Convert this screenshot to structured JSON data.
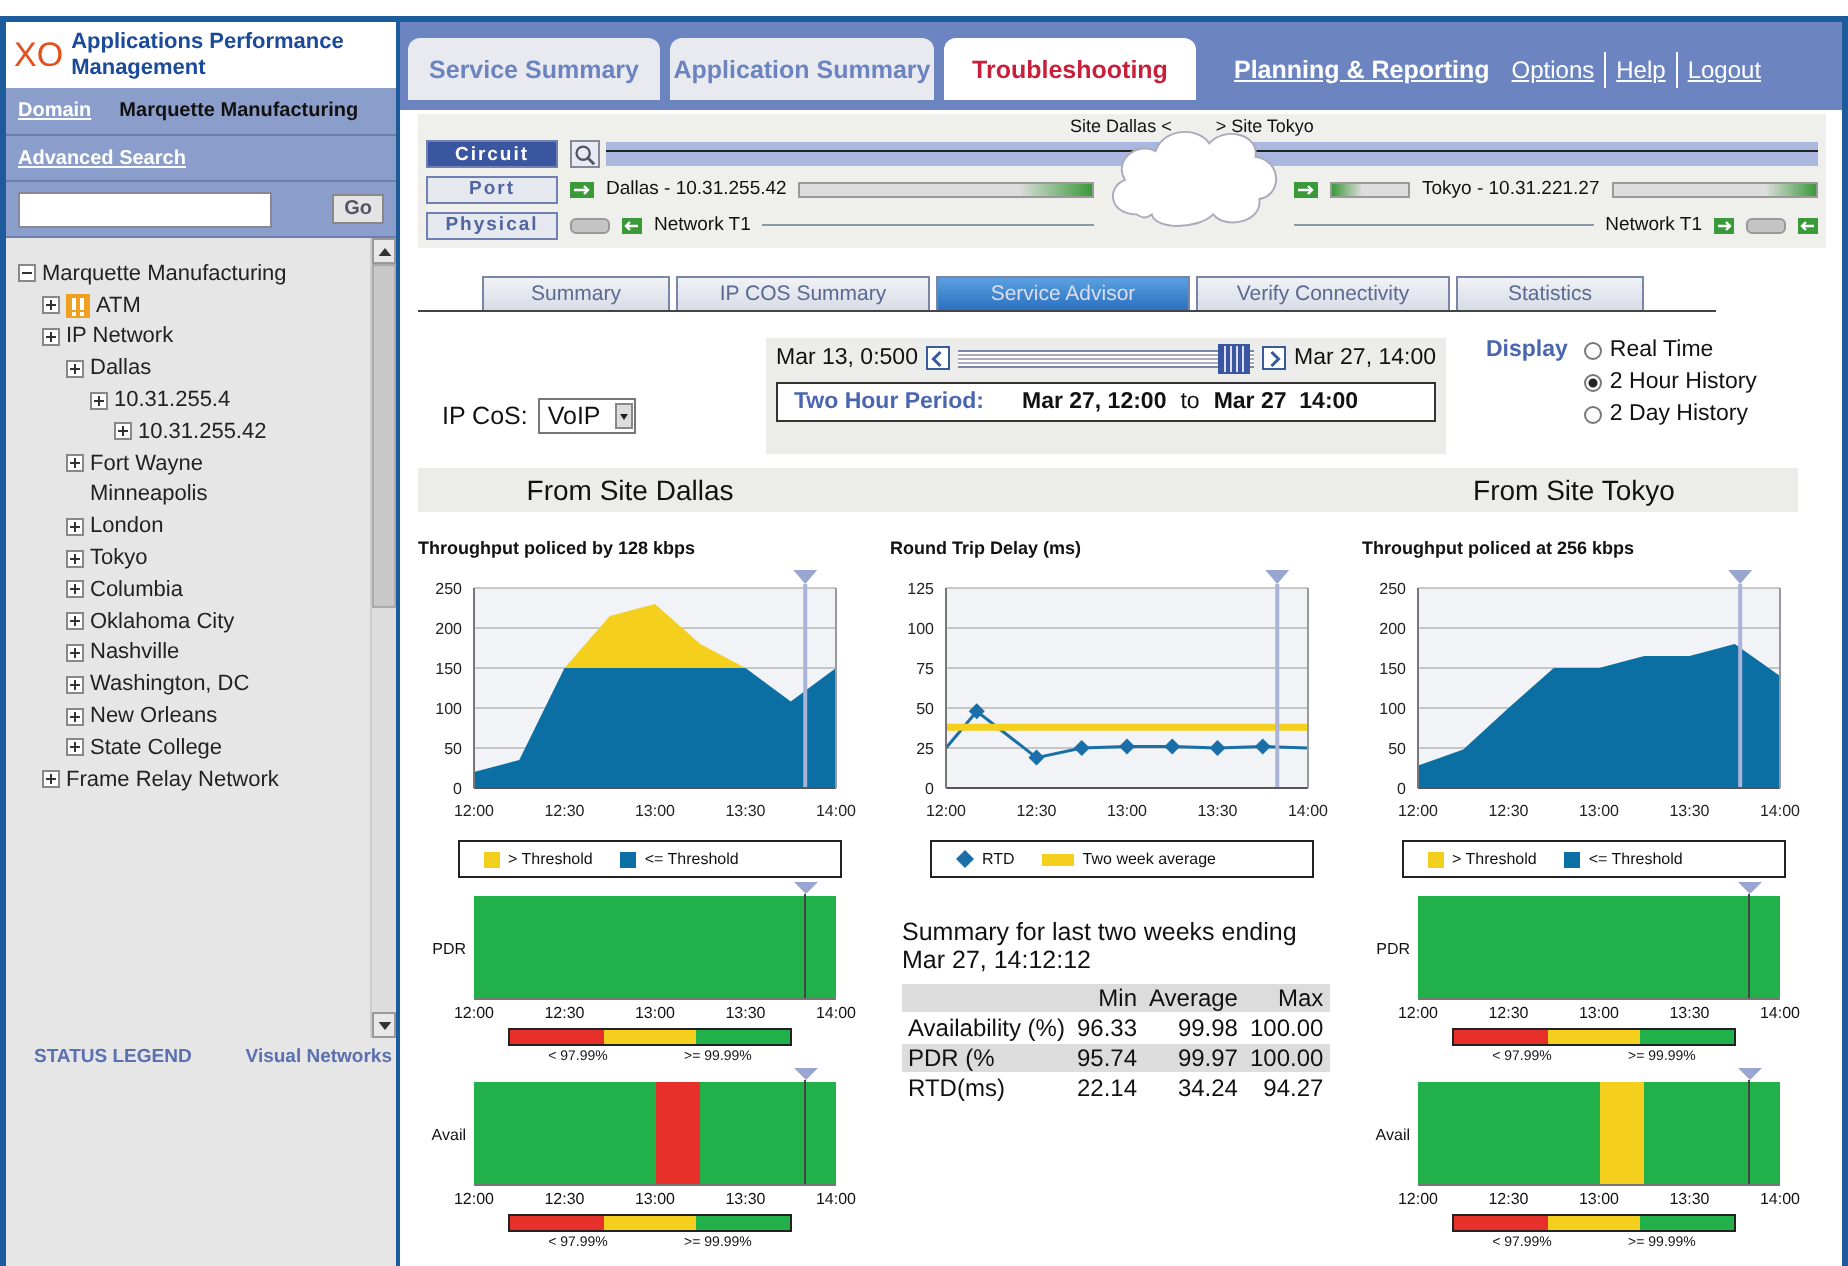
{
  "sidebar": {
    "logo": "XO",
    "title": "Applications Performance Management",
    "domain_link": "Domain",
    "domain_value": "Marquette Manufacturing",
    "advanced_search": "Advanced Search",
    "search": {
      "button": "Go"
    },
    "tree": [
      {
        "label": "Marquette Manufacturing",
        "expanded": true,
        "alert": false,
        "children": [
          {
            "label": "ATM",
            "expanded": false,
            "alert": true
          },
          {
            "label": "IP Network",
            "expanded": false,
            "alert": false,
            "children": [
              {
                "label": "Dallas",
                "expanded": false,
                "alert": false,
                "children": [
                  {
                    "label": "10.31.255.4",
                    "expanded": false,
                    "alert": false,
                    "children": [
                      {
                        "label": "10.31.255.42",
                        "expanded": false,
                        "alert": false
                      }
                    ]
                  }
                ]
              },
              {
                "label": "Fort Wayne",
                "expanded": false,
                "alert": false
              },
              {
                "label": "Minneapolis",
                "alert": false
              },
              {
                "label": "London",
                "expanded": false,
                "alert": false
              },
              {
                "label": "Tokyo",
                "expanded": false,
                "alert": false
              },
              {
                "label": "Columbia",
                "expanded": false,
                "alert": false
              },
              {
                "label": "Oklahoma City",
                "expanded": false,
                "alert": false
              },
              {
                "label": "Nashville",
                "expanded": false,
                "alert": false
              },
              {
                "label": "Washington, DC",
                "expanded": false,
                "alert": false
              },
              {
                "label": "New Orleans",
                "expanded": false,
                "alert": false
              },
              {
                "label": "State College",
                "expanded": false,
                "alert": false
              }
            ]
          },
          {
            "label": "Frame Relay Network",
            "expanded": false,
            "alert": false
          }
        ]
      }
    ],
    "footer_left": "STATUS LEGEND",
    "footer_right": "Visual Networks"
  },
  "nav": {
    "tabs": [
      {
        "label": "Service Summary",
        "selected": false
      },
      {
        "label": "Application Summary",
        "selected": false
      },
      {
        "label": "Troubleshooting",
        "selected": true
      }
    ],
    "links": [
      {
        "label": "Planning & Reporting",
        "kind": "primary"
      },
      {
        "label": "Options",
        "kind": "secondary"
      },
      {
        "label": "Help",
        "kind": "secondary"
      },
      {
        "label": "Logout",
        "kind": "secondary"
      }
    ]
  },
  "circuit": {
    "site_left": "Site Dallas <",
    "site_right": "> Site Tokyo",
    "buttons": [
      {
        "label": "Circuit",
        "selected": true
      },
      {
        "label": "Port",
        "selected": false
      },
      {
        "label": "Physical",
        "selected": false
      }
    ],
    "port_left": "Dallas - 10.31.255.42",
    "port_right": "Tokyo - 10.31.221.27",
    "physical_left": "Network T1",
    "physical_right": "Network T1"
  },
  "subtabs": [
    {
      "label": "Summary",
      "selected": false
    },
    {
      "label": "IP COS Summary",
      "selected": false
    },
    {
      "label": "Service Advisor",
      "selected": true
    },
    {
      "label": "Verify Connectivity",
      "selected": false
    },
    {
      "label": "Statistics",
      "selected": false
    }
  ],
  "controls": {
    "cos_label": "IP CoS:",
    "cos_value": "VoIP",
    "slider": {
      "start": "Mar 13, 0:500",
      "end": "Mar 27, 14:00",
      "level": 0.93
    },
    "period": {
      "label": "Two Hour Period:",
      "from": "Mar 27, 12:00",
      "sep": "to",
      "to": "Mar 27  14:00"
    },
    "display": {
      "label": "Display",
      "options": [
        {
          "label": "Real Time",
          "selected": false
        },
        {
          "label": "2 Hour History",
          "selected": true
        },
        {
          "label": "2 Day History",
          "selected": false
        }
      ]
    }
  },
  "sites": [
    "From Site Dallas",
    "From Site Tokyo"
  ],
  "columns": [
    {
      "chart_data": {
        "type": "area",
        "title": "Throughput policed by 128 kbps",
        "stacked": true,
        "grid": true,
        "x": [
          12,
          12.25,
          12.5,
          12.75,
          13,
          13.25,
          13.5,
          13.75,
          14
        ],
        "series": [
          {
            "name": "> Threshold",
            "color": "#f5cf1e",
            "values": [
              0,
              0,
              0,
              65,
              80,
              30,
              0,
              0,
              0
            ]
          },
          {
            "name": "<= Threshold",
            "color": "#0b6fa4",
            "values": [
              20,
              35,
              150,
              150,
              150,
              150,
              150,
              108,
              150
            ]
          }
        ],
        "legend": true,
        "xlim": [
          12,
          14
        ],
        "ylim": [
          0,
          250
        ],
        "xticks": [
          {
            "value": 12,
            "label": "12:00"
          },
          {
            "value": 12.5,
            "label": "12:30"
          },
          {
            "value": 13,
            "label": "13:00"
          },
          {
            "value": 13.5,
            "label": "13:30"
          },
          {
            "value": 14,
            "label": "14:00"
          }
        ],
        "yticks": [
          0,
          50,
          100,
          150,
          200,
          250
        ],
        "ref_lines": [
          {
            "axis": "x",
            "value": 13.83
          }
        ]
      },
      "strips": [
        {
          "label": "PDR",
          "slots": [
            {
              "color": "#22b04a"
            },
            {
              "color": "#22b04a"
            },
            {
              "color": "#22b04a"
            },
            {
              "color": "#22b04a"
            },
            {
              "color": "#22b04a"
            },
            {
              "color": "#22b04a"
            },
            {
              "color": "#22b04a"
            },
            {
              "color": "#22b04a"
            }
          ],
          "ticks": [
            "12:00",
            "12:30",
            "13:00",
            "13:30",
            "14:00"
          ],
          "scale": {
            "bands": [
              {
                "color": "#e8302a"
              },
              {
                "color": "#f5cf1e"
              },
              {
                "color": "#22b04a"
              }
            ],
            "low": "< 97.99%",
            "high": ">= 99.99%"
          }
        },
        {
          "label": "Avail",
          "slots": [
            {
              "color": "#22b04a"
            },
            {
              "color": "#22b04a"
            },
            {
              "color": "#22b04a"
            },
            {
              "color": "#22b04a"
            },
            {
              "color": "#e8302a"
            },
            {
              "color": "#22b04a"
            },
            {
              "color": "#22b04a"
            },
            {
              "color": "#22b04a"
            }
          ],
          "ticks": [
            "12:00",
            "12:30",
            "13:00",
            "13:30",
            "14:00"
          ],
          "scale": {
            "bands": [
              {
                "color": "#e8302a"
              },
              {
                "color": "#f5cf1e"
              },
              {
                "color": "#22b04a"
              }
            ],
            "low": "< 97.99%",
            "high": ">= 99.99%"
          }
        }
      ]
    },
    {
      "chart_data": {
        "type": "line",
        "title": "Round Trip Delay (ms)",
        "grid": true,
        "x": [
          12,
          12.17,
          12.5,
          12.75,
          13,
          13.25,
          13.5,
          13.75,
          14
        ],
        "series": [
          {
            "name": "RTD",
            "color": "#1a6fa8",
            "marker": "diamond",
            "values": [
              25,
              48,
              19,
              25,
              26,
              26,
              25,
              26,
              25
            ]
          },
          {
            "name": "Two week average",
            "color": "#f5cf1e",
            "values": [
              38,
              38,
              38,
              38,
              38,
              38,
              38,
              38,
              38
            ]
          }
        ],
        "legend": true,
        "xlim": [
          12,
          14
        ],
        "ylim": [
          0,
          125
        ],
        "xticks": [
          {
            "value": 12,
            "label": "12:00"
          },
          {
            "value": 12.5,
            "label": "12:30"
          },
          {
            "value": 13,
            "label": "13:00"
          },
          {
            "value": 13.5,
            "label": "13:30"
          },
          {
            "value": 14,
            "label": "14:00"
          }
        ],
        "yticks": [
          0,
          25,
          50,
          75,
          100,
          125
        ],
        "ref_lines": [
          {
            "axis": "x",
            "value": 13.83
          }
        ]
      },
      "summary": {
        "title": "Summary for last two weeks ending Mar 27, 14:12:12",
        "columns": [
          "Min",
          "Average",
          "Max"
        ],
        "rows": [
          {
            "label": "Availability (%)",
            "values": [
              "96.33",
              "99.98",
              "100.00"
            ]
          },
          {
            "label": "PDR (%",
            "values": [
              "95.74",
              "99.97",
              "100.00"
            ]
          },
          {
            "label": "RTD(ms)",
            "values": [
              "22.14",
              "34.24",
              "94.27"
            ]
          }
        ]
      }
    },
    {
      "chart_data": {
        "type": "area",
        "title": "Throughput policed at 256 kbps",
        "stacked": true,
        "grid": true,
        "x": [
          12,
          12.25,
          12.5,
          12.75,
          13,
          13.25,
          13.5,
          13.75,
          14
        ],
        "series": [
          {
            "name": "> Threshold",
            "color": "#f5cf1e",
            "values": [
              null,
              null,
              null,
              null,
              null,
              null,
              null,
              null,
              null
            ]
          },
          {
            "name": "<= Threshold",
            "color": "#0b6fa4",
            "values": [
              28,
              48,
              100,
              150,
              150,
              165,
              165,
              180,
              140
            ]
          }
        ],
        "legend": true,
        "xlim": [
          12,
          14
        ],
        "ylim": [
          0,
          250
        ],
        "xticks": [
          {
            "value": 12,
            "label": "12:00"
          },
          {
            "value": 12.5,
            "label": "12:30"
          },
          {
            "value": 13,
            "label": "13:00"
          },
          {
            "value": 13.5,
            "label": "13:30"
          },
          {
            "value": 14,
            "label": "14:00"
          }
        ],
        "yticks": [
          0,
          50,
          100,
          150,
          200,
          250
        ],
        "ref_lines": [
          {
            "axis": "x",
            "value": 13.78
          }
        ]
      },
      "strips": [
        {
          "label": "PDR",
          "slots": [
            {
              "color": "#22b04a"
            },
            {
              "color": "#22b04a"
            },
            {
              "color": "#22b04a"
            },
            {
              "color": "#22b04a"
            },
            {
              "color": "#22b04a"
            },
            {
              "color": "#22b04a"
            },
            {
              "color": "#22b04a"
            },
            {
              "color": "#22b04a"
            }
          ],
          "ticks": [
            "12:00",
            "12:30",
            "13:00",
            "13:30",
            "14:00"
          ],
          "scale": {
            "bands": [
              {
                "color": "#e8302a"
              },
              {
                "color": "#f5cf1e"
              },
              {
                "color": "#22b04a"
              }
            ],
            "low": "< 97.99%",
            "high": ">= 99.99%"
          }
        },
        {
          "label": "Avail",
          "slots": [
            {
              "color": "#22b04a"
            },
            {
              "color": "#22b04a"
            },
            {
              "color": "#22b04a"
            },
            {
              "color": "#22b04a"
            },
            {
              "color": "#f5cf1e"
            },
            {
              "color": "#22b04a"
            },
            {
              "color": "#22b04a"
            },
            {
              "color": "#22b04a"
            }
          ],
          "ticks": [
            "12:00",
            "12:30",
            "13:00",
            "13:30",
            "14:00"
          ],
          "scale": {
            "bands": [
              {
                "color": "#e8302a"
              },
              {
                "color": "#f5cf1e"
              },
              {
                "color": "#22b04a"
              }
            ],
            "low": "< 97.99%",
            "high": ">= 99.99%"
          }
        }
      ]
    }
  ]
}
